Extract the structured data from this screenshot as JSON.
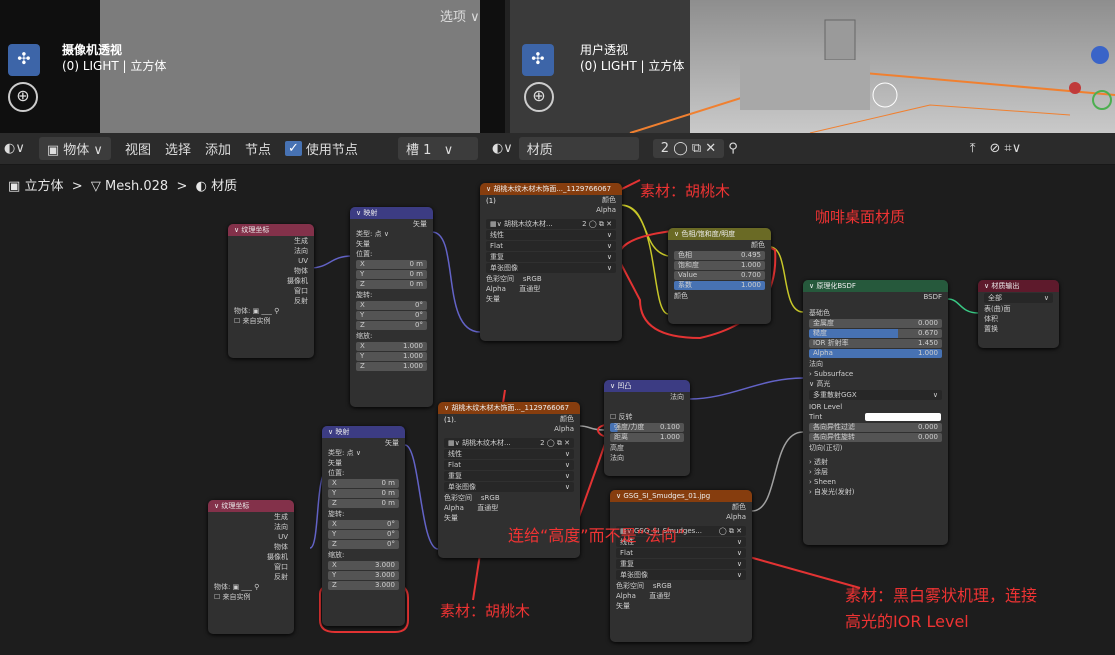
{
  "viewport_left": {
    "title": "摄像机透视",
    "subtitle": "(0) LIGHT | 立方体",
    "options": "选项 ∨"
  },
  "viewport_right": {
    "title": "用户透视",
    "subtitle": "(0) LIGHT | 立方体"
  },
  "toolbar": {
    "mode": "物体",
    "view": "视图",
    "select": "选择",
    "add": "添加",
    "node": "节点",
    "use_nodes": "使用节点",
    "slot": "槽 1",
    "material": "材质",
    "users": "2"
  },
  "breadcrumb": {
    "object": "立方体",
    "mesh": "Mesh.028",
    "material": "材质"
  },
  "texcoord1": {
    "title": "纹理坐标",
    "outputs": [
      "生成",
      "法向",
      "UV",
      "物体",
      "摄像机",
      "窗口",
      "反射"
    ],
    "object_label": "物体:",
    "from_instancer": "来自实例"
  },
  "mapping1": {
    "title": "映射",
    "vector_out": "矢量",
    "type_label": "类型:",
    "type_value": "点",
    "vector_in": "矢量",
    "location": "位置:",
    "loc": [
      [
        "X",
        "0 m"
      ],
      [
        "Y",
        "0 m"
      ],
      [
        "Z",
        "0 m"
      ]
    ],
    "rotation": "旋转:",
    "rot": [
      [
        "X",
        "0°"
      ],
      [
        "Y",
        "0°"
      ],
      [
        "Z",
        "0°"
      ]
    ],
    "scale": "缩放:",
    "scl": [
      [
        "X",
        "1.000"
      ],
      [
        "Y",
        "1.000"
      ],
      [
        "Z",
        "1.000"
      ]
    ]
  },
  "image1": {
    "title": "胡桃木纹木材木饰面..._1129766067 (1)",
    "color": "颜色",
    "alpha": "Alpha",
    "img": "胡桃木纹木材...",
    "users": "2",
    "interp": "线性",
    "proj": "Flat",
    "ext": "重复",
    "source": "单张图像",
    "cs_label": "色彩空间",
    "cs_value": "sRGB",
    "alpha_label": "Alpha",
    "alpha_value": "直通型",
    "vector": "矢量"
  },
  "hsv": {
    "title": "色相/饱和度/明度",
    "color_out": "颜色",
    "rows": [
      [
        "色相",
        "0.495"
      ],
      [
        "饱和度",
        "1.000"
      ],
      [
        "Value",
        "0.700"
      ],
      [
        "系数",
        "1.000"
      ]
    ],
    "color_in": "颜色"
  },
  "bsdf": {
    "title": "原理化BSDF",
    "out": "BSDF",
    "base": "基础色",
    "rows": [
      [
        "金属度",
        "0.000"
      ],
      [
        "糙度",
        "0.670"
      ],
      [
        "IOR 折射率",
        "1.450"
      ],
      [
        "Alpha",
        "1.000"
      ]
    ],
    "normal": "法向",
    "subsurface": "Subsurface",
    "specular": "高光",
    "dist": "多重散射GGX",
    "ior_level": "IOR Level",
    "tint": "Tint",
    "aniso": [
      [
        "各向异性过滤",
        "0.000"
      ],
      [
        "各向异性旋转",
        "0.000"
      ]
    ],
    "tangent": "切向(正切)",
    "closed": [
      "透射",
      "涂层",
      "Sheen",
      "自发光(发射)"
    ]
  },
  "output": {
    "title": "材质输出",
    "target": "全部",
    "inputs": [
      "表(曲)面",
      "体积",
      "置换"
    ]
  },
  "bump": {
    "title": "凹凸",
    "normal_out": "法向",
    "invert": "反转",
    "strength": [
      "强度/力度",
      "0.100"
    ],
    "distance": [
      "距离",
      "1.000"
    ],
    "height": "高度",
    "normal_in": "法向"
  },
  "texcoord2": {
    "title": "纹理坐标",
    "outputs": [
      "生成",
      "法向",
      "UV",
      "物体",
      "摄像机",
      "窗口",
      "反射"
    ],
    "object_label": "物体:",
    "from_instancer": "来自实例"
  },
  "mapping2": {
    "title": "映射",
    "vector_out": "矢量",
    "type_label": "类型:",
    "type_value": "点",
    "vector_in": "矢量",
    "location": "位置:",
    "loc": [
      [
        "X",
        "0 m"
      ],
      [
        "Y",
        "0 m"
      ],
      [
        "Z",
        "0 m"
      ]
    ],
    "rotation": "旋转:",
    "rot": [
      [
        "X",
        "0°"
      ],
      [
        "Y",
        "0°"
      ],
      [
        "Z",
        "0°"
      ]
    ],
    "scale": "缩放:",
    "scl": [
      [
        "X",
        "3.000"
      ],
      [
        "Y",
        "3.000"
      ],
      [
        "Z",
        "3.000"
      ]
    ]
  },
  "image2": {
    "title": "胡桃木纹木材木饰面..._1129766067 (1).",
    "color": "颜色",
    "alpha": "Alpha",
    "img": "胡桃木纹木材...",
    "users": "2",
    "interp": "线性",
    "proj": "Flat",
    "ext": "重复",
    "source": "单张图像",
    "cs_label": "色彩空间",
    "cs_value": "sRGB",
    "alpha_label": "Alpha",
    "alpha_value": "直通型",
    "vector": "矢量"
  },
  "image3": {
    "title": "GSG_SI_Smudges_01.jpg",
    "color": "颜色",
    "alpha": "Alpha",
    "img": "GSG_SI_Smudges...",
    "interp": "线性",
    "proj": "Flat",
    "ext": "重复",
    "source": "单张图像",
    "cs_label": "色彩空间",
    "cs_value": "sRGB",
    "alpha_label": "Alpha",
    "alpha_value": "直通型",
    "vector": "矢量"
  },
  "annotations": {
    "walnut_top": "素材：胡桃木",
    "coffee": "咖啡桌面材质",
    "walnut_bottom": "素材：胡桃木",
    "height_note": "连给“高度”而不是“法向”",
    "smudge1": "素材：黑白雾状机理，连接",
    "smudge2": "高光的IOR Level"
  },
  "colors": {
    "accent": "#4772b3",
    "annotation": "#e33333",
    "header_input": "#83314a",
    "header_vector": "#3c3c83",
    "header_texture": "#863d0e",
    "header_color": "#6a6a25",
    "header_shader": "#26593c",
    "header_output": "#5e1a2c"
  }
}
